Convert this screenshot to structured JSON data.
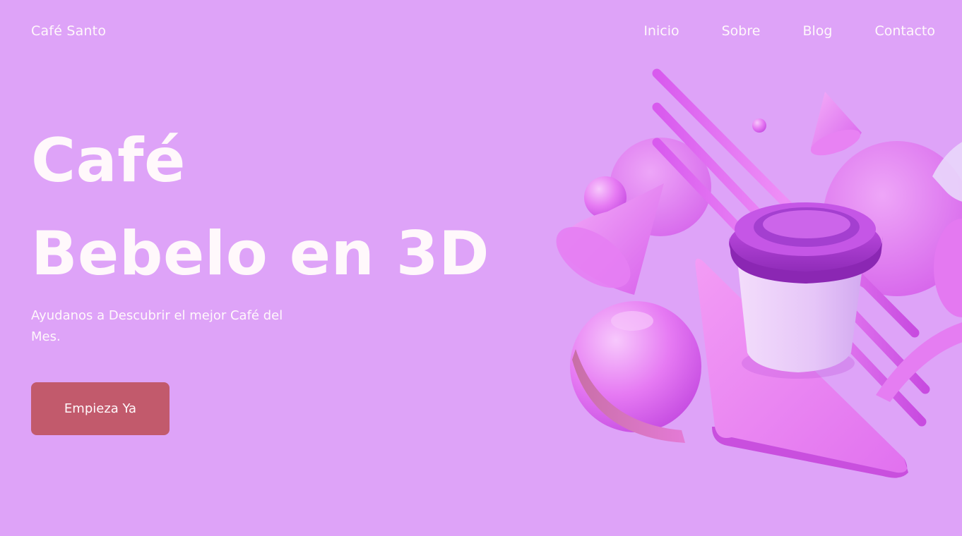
{
  "header": {
    "logo": "Café Santo",
    "nav": [
      "Inicio",
      "Sobre",
      "Blog",
      "Contacto"
    ]
  },
  "hero": {
    "title_line1": "Café",
    "title_line2": "Bebelo en 3D",
    "subtitle": "Ayudanos a Descubrir el mejor Café del Mes.",
    "cta_label": "Empieza Ya"
  },
  "colors": {
    "background": "#dea3f8",
    "text": "#fff8fb",
    "button": "#c25a6c",
    "accent_magenta": "#e070f0"
  },
  "illustration": {
    "subject": "3D coffee cup with geometric shapes"
  }
}
